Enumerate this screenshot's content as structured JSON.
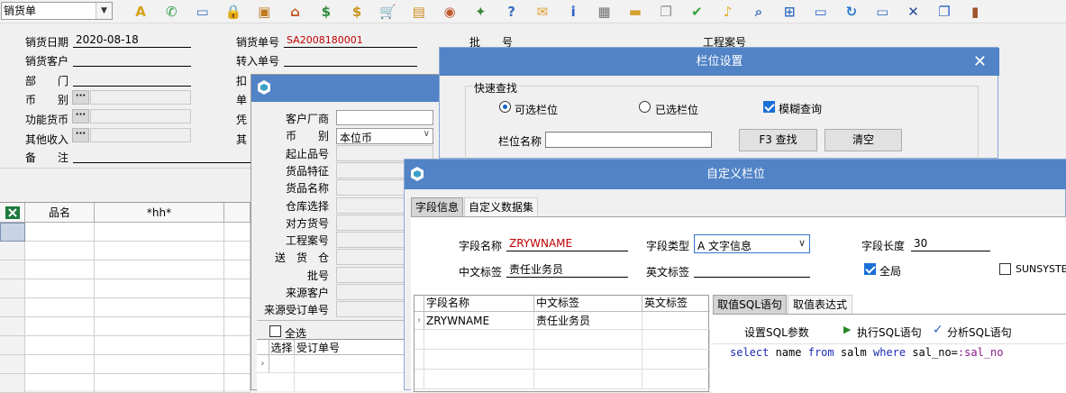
{
  "toolbar": {
    "doc_type": "销货单",
    "icons": [
      "spell-check-icon",
      "phone-icon",
      "computer-icon",
      "lock-icon",
      "briefcase-icon",
      "home-icon",
      "dollar-icon",
      "money-bag-icon",
      "cart-icon",
      "clipboard-icon",
      "users-icon",
      "satellite-icon",
      "help-page-icon",
      "mail-icon",
      "info-icon",
      "calculator-icon",
      "folder-icon",
      "copy-icon",
      "check-circle-icon",
      "bell-icon",
      "search-icon",
      "org-chart-icon",
      "monitor-icon",
      "refresh-icon",
      "window-icon",
      "close-window-icon",
      "restore-icon",
      "exit-door-icon"
    ]
  },
  "form": {
    "date_label": "销货日期",
    "date_value": "2020-08-18",
    "doc_no_label": "销货单号",
    "doc_no_value": "SA2008180001",
    "batch_label": "批　　号",
    "project_label": "工程案号",
    "customer_label": "销货客户",
    "transfer_label": "转入单号",
    "dept_label": "部　　门",
    "deduct_label": "扣",
    "currency_label": "币　　别",
    "unit_label": "单",
    "func_currency_label": "功能货币",
    "voucher_label": "凭",
    "other_income_label": "其他收入",
    "other_label": "其",
    "note_label": "备　　注",
    "dots": "···"
  },
  "grid": {
    "columns": [
      "品名",
      "*hh*"
    ]
  },
  "filter_panel": {
    "fields": [
      "客户厂商",
      "币　　别",
      "起止品号",
      "货品特征",
      "货品名称",
      "仓库选择",
      "对方货号",
      "工程案号",
      "送　货　仓",
      "批号",
      "来源客户",
      "来源受订单号"
    ],
    "currency_value": "本位币",
    "select_all": "全选",
    "list_cols": [
      "选择",
      "受订单号"
    ]
  },
  "column_settings": {
    "title": "栏位设置",
    "group_title": "快速查找",
    "radio_available": "可选栏位",
    "radio_selected": "已选栏位",
    "fuzzy": "模糊查询",
    "field_name_label": "栏位名称",
    "find_button": "F3 查找",
    "clear_button": "清空"
  },
  "custom_column": {
    "title": "自定义栏位",
    "tabs": [
      "字段信息",
      "自定义数据集"
    ],
    "field_name_label": "字段名称",
    "field_name_value": "ZRYWNAME",
    "field_type_label": "字段类型",
    "field_type_value": "A 文字信息",
    "field_length_label": "字段长度",
    "field_length_value": "30",
    "cn_label": "中文标签",
    "cn_value": "责任业务员",
    "en_label": "英文标签",
    "global_label": "全局",
    "sunsystem_label": "SUNSYSTE",
    "list_headers": [
      "字段名称",
      "中文标签",
      "英文标签"
    ],
    "list_row": [
      "ZRYWNAME",
      "责任业务员",
      ""
    ],
    "sql_tabs": [
      "取值SQL语句",
      "取值表达式"
    ],
    "set_params": "设置SQL参数",
    "exec_sql": "执行SQL语句",
    "analyze_sql": "分析SQL语句",
    "sql_text": {
      "kw1": "select",
      "t1": " name ",
      "kw2": "from",
      "t2": " salm ",
      "kw3": "where",
      "t3": " sal_no=",
      "param": ":sal_no"
    }
  }
}
